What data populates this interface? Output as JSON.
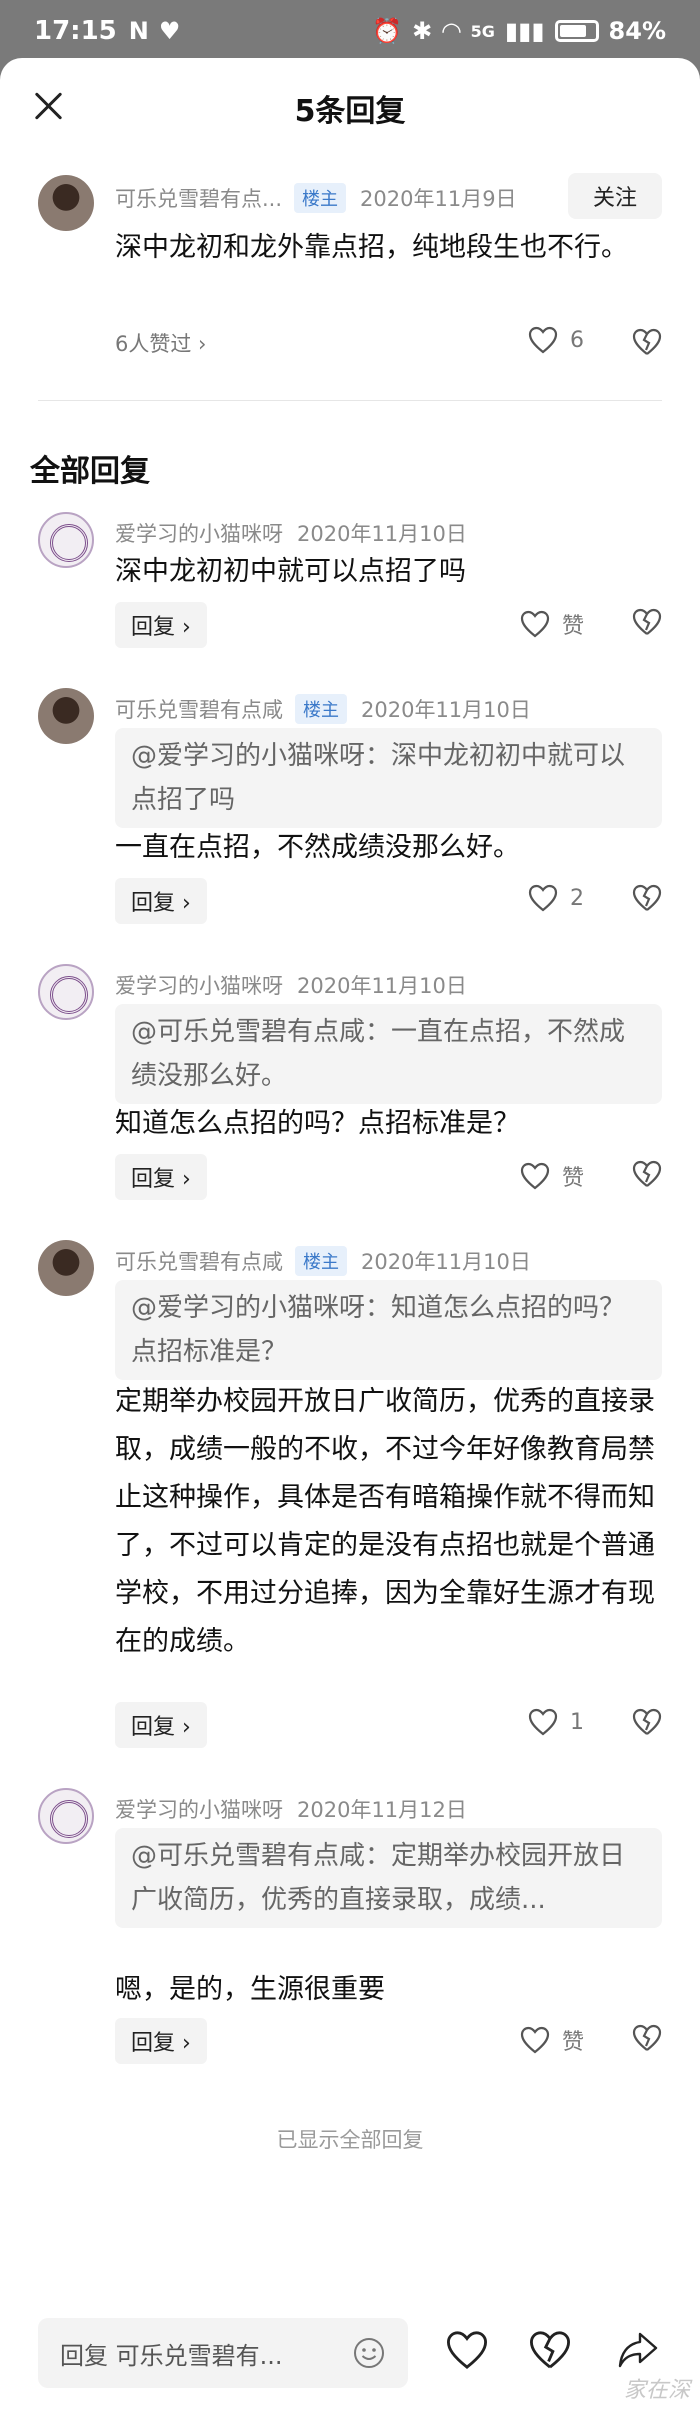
{
  "status_bar": {
    "time": "17:15",
    "network": "5G",
    "battery": "84%"
  },
  "sheet": {
    "title": "5条回复",
    "follow_label": "关注"
  },
  "main_post": {
    "author": "可乐兑雪碧有点...",
    "badge": "楼主",
    "date": "2020年11月9日",
    "content": "深中龙初和龙外靠点招，纯地段生也不行。",
    "likes_link": "6人赞过 ›",
    "like_count": "6"
  },
  "section_title": "全部回复",
  "replies": [
    {
      "author": "爱学习的小猫咪呀",
      "badge": "",
      "date": "2020年11月10日",
      "quote": "",
      "content": "深中龙初初中就可以点招了吗",
      "reply_label": "回复 ›",
      "like_label": "赞"
    },
    {
      "author": "可乐兑雪碧有点咸",
      "badge": "楼主",
      "date": "2020年11月10日",
      "quote": "@爱学习的小猫咪呀：深中龙初初中就可以点招了吗",
      "content": "一直在点招，不然成绩没那么好。",
      "reply_label": "回复 ›",
      "like_label": "2"
    },
    {
      "author": "爱学习的小猫咪呀",
      "badge": "",
      "date": "2020年11月10日",
      "quote": "@可乐兑雪碧有点咸：一直在点招，不然成绩没那么好。",
      "content": "知道怎么点招的吗？点招标准是？",
      "reply_label": "回复 ›",
      "like_label": "赞"
    },
    {
      "author": "可乐兑雪碧有点咸",
      "badge": "楼主",
      "date": "2020年11月10日",
      "quote": "@爱学习的小猫咪呀：知道怎么点招的吗？点招标准是？",
      "content": "定期举办校园开放日广收简历，优秀的直接录取，成绩一般的不收，不过今年好像教育局禁止这种操作，具体是否有暗箱操作就不得而知了，不过可以肯定的是没有点招也就是个普通学校，不用过分追捧，因为全靠好生源才有现在的成绩。",
      "reply_label": "回复 ›",
      "like_label": "1"
    },
    {
      "author": "爱学习的小猫咪呀",
      "badge": "",
      "date": "2020年11月12日",
      "quote": "@可乐兑雪碧有点咸：定期举办校园开放日广收简历，优秀的直接录取，成绩...",
      "content": "嗯，是的，生源很重要",
      "reply_label": "回复 ›",
      "like_label": "赞"
    }
  ],
  "end_note": "已显示全部回复",
  "bottom_bar": {
    "placeholder": "回复 可乐兑雪碧有..."
  },
  "watermark": "家在深"
}
